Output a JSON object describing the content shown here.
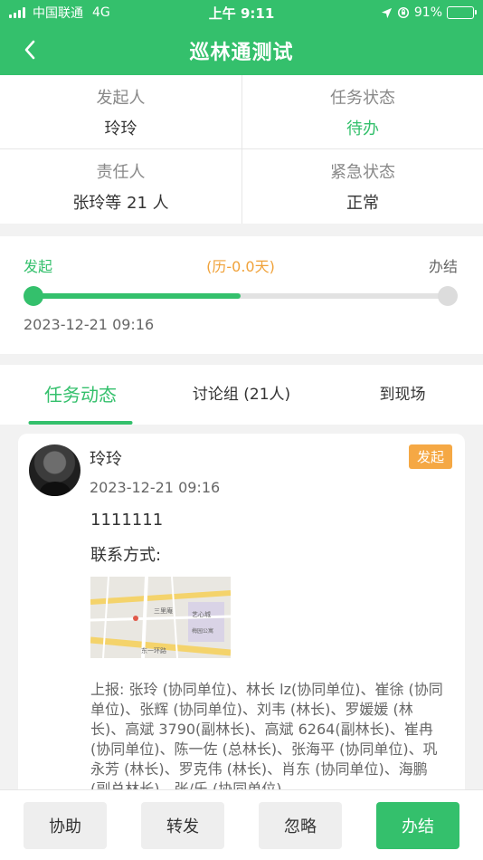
{
  "status_bar": {
    "carrier": "中国联通",
    "network": "4G",
    "time": "上午 9:11",
    "battery_percent": "91%",
    "battery_level": 0.91
  },
  "nav": {
    "back_icon": "chevron-left-icon",
    "title": "巡林通测试"
  },
  "info": {
    "initiator_label": "发起人",
    "initiator_value": "玲玲",
    "task_status_label": "任务状态",
    "task_status_value": "待办",
    "responsible_label": "责任人",
    "responsible_value": "张玲等 21 人",
    "urgency_label": "紧急状态",
    "urgency_value": "正常"
  },
  "progress": {
    "start_label": "发起",
    "duration_label": "(历-0.0天)",
    "end_label": "办结",
    "percent": 50,
    "start_date": "2023-12-21 09:16"
  },
  "tabs": [
    {
      "label": "任务动态",
      "active": true
    },
    {
      "label": "讨论组 (21人)",
      "active": false
    },
    {
      "label": "到现场",
      "active": false
    }
  ],
  "feed": {
    "author": "玲玲",
    "time": "2023-12-21 09:16",
    "badge": "发起",
    "message": "1111111",
    "contact_label": "联系方式:",
    "map_labels": {
      "a": "三里庵",
      "b": "艺心城",
      "c": "梅园公寓",
      "d": "东一环路"
    },
    "report": "上报: 张玲 (协同单位)、林长 lz(协同单位)、崔徐 (协同单位)、张辉 (协同单位)、刘韦 (林长)、罗媛媛 (林长)、高斌 3790(副林长)、高斌 6264(副林长)、崔冉 (协同单位)、陈一佐 (总林长)、张海平 (协同单位)、巩永芳 (林长)、罗克伟 (林长)、肖东 (协同单位)、海鹏 (副总林长)、张/乐 (协同单位)"
  },
  "actions": {
    "assist": "协助",
    "forward": "转发",
    "ignore": "忽略",
    "complete": "办结"
  },
  "colors": {
    "brand_green": "#34c06c",
    "badge_orange": "#f5a844",
    "duration_orange": "#f0a23a"
  }
}
